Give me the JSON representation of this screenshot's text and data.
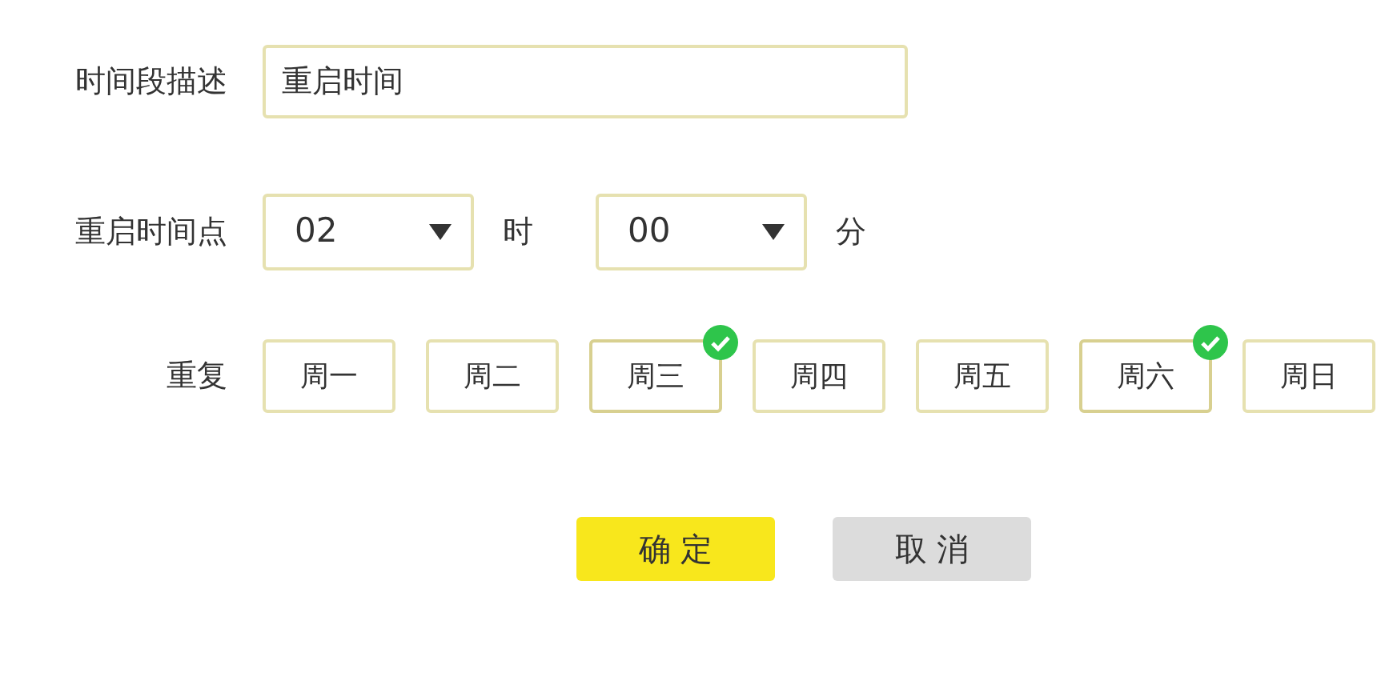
{
  "description": {
    "label": "时间段描述",
    "value": "重启时间"
  },
  "restart_time": {
    "label": "重启时间点",
    "hour": {
      "value": "02",
      "unit": "时"
    },
    "minute": {
      "value": "00",
      "unit": "分"
    }
  },
  "repeat": {
    "label": "重复",
    "days": [
      {
        "label": "周一",
        "checked": false
      },
      {
        "label": "周二",
        "checked": false
      },
      {
        "label": "周三",
        "checked": true
      },
      {
        "label": "周四",
        "checked": false
      },
      {
        "label": "周五",
        "checked": false
      },
      {
        "label": "周六",
        "checked": true
      },
      {
        "label": "周日",
        "checked": false
      }
    ]
  },
  "buttons": [
    {
      "label": "确 定",
      "kind": "primary"
    },
    {
      "label": "取 消",
      "kind": "secondary"
    }
  ]
}
